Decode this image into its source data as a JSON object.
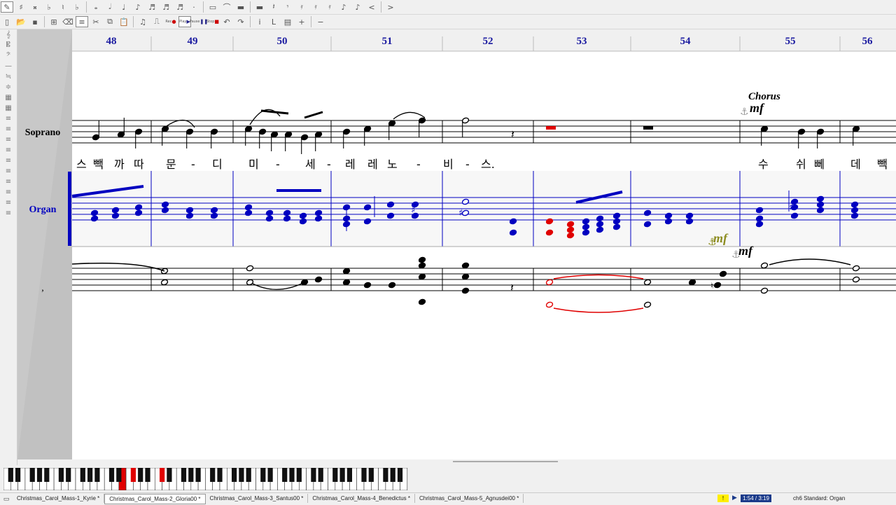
{
  "toolbar1": {
    "buttons": [
      "pencil-icon",
      "sharp-icon",
      "double-sharp-icon",
      "flat-icon",
      "natural-icon",
      "double-flat-icon",
      "whole-note-icon",
      "half-note-icon",
      "quarter-note-icon",
      "eighth-note-icon",
      "sixteenth-note-icon",
      "thirtysecond-note-icon",
      "sixtyfourth-note-icon",
      "dot-icon",
      "rest-icon",
      "tie-icon",
      "whole-rest-icon",
      "half-rest-icon",
      "quarter-rest-icon",
      "eighth-rest-icon",
      "sixteenth-rest-icon",
      "thirtysecond-rest-icon",
      "sixtyfourth-rest-icon",
      "grace-note-icon",
      "grace-slash-icon",
      "prev-icon",
      "next-icon"
    ]
  },
  "toolbar2": {
    "buttons": [
      "new-icon",
      "open-icon",
      "save-icon",
      "select-icon",
      "erase-icon",
      "staff-icon",
      "cut-icon",
      "copy-icon",
      "paste-icon",
      "note-mode-icon",
      "beam-icon",
      "undo-icon",
      "redo-icon",
      "info-icon",
      "lyrics-icon",
      "view-icon",
      "zoom-in-icon",
      "zoom-out-icon"
    ],
    "rec_label": "Rec",
    "play_label": "Play",
    "pause_label": "Pause",
    "stop_label": "Stop"
  },
  "score": {
    "measures": [
      "48",
      "49",
      "50",
      "51",
      "52",
      "53",
      "54",
      "55",
      "56"
    ],
    "staves": [
      {
        "name": "Soprano",
        "color": "#000000"
      },
      {
        "name": "Organ",
        "color": "#0000c0"
      },
      {
        "name": ",",
        "color": "#000000"
      }
    ],
    "lyrics": [
      "스",
      "빽",
      "까",
      "따",
      "문",
      "-",
      "디",
      "미",
      "-",
      "세",
      "-",
      "레",
      "레",
      "노",
      "-",
      "비",
      "-",
      "스."
    ],
    "lyrics2": [
      "수",
      "쉬",
      "뻬",
      "데",
      "빽"
    ],
    "annotations": {
      "chorus": "Chorus",
      "dyn1": "mf",
      "dyn2": "mf",
      "dyn3": "mf"
    },
    "colors": {
      "measure_number": "#1a1aa0",
      "organ": "#0000c0",
      "highlight": "#e00000",
      "dynamic": "#8c8c20"
    }
  },
  "piano": {
    "octaves": 8,
    "pressed_white": [
      16
    ],
    "pressed_black": [
      12,
      15
    ]
  },
  "tabs": [
    {
      "label": "Christmas_Carol_Mass-1_Kyrie *",
      "active": false
    },
    {
      "label": "Christmas_Carol_Mass-2_Gloria00 *",
      "active": true
    },
    {
      "label": "Christmas_Carol_Mass-3_Santus00 *",
      "active": false
    },
    {
      "label": "Christmas_Carol_Mass-4_Benedictus *",
      "active": false
    },
    {
      "label": "Christmas_Carol_Mass-5_Agnusdei00 *",
      "active": false
    }
  ],
  "status": {
    "warning": "!",
    "time": "1:54 / 3:19",
    "device": "ch6 Standard: Organ"
  }
}
